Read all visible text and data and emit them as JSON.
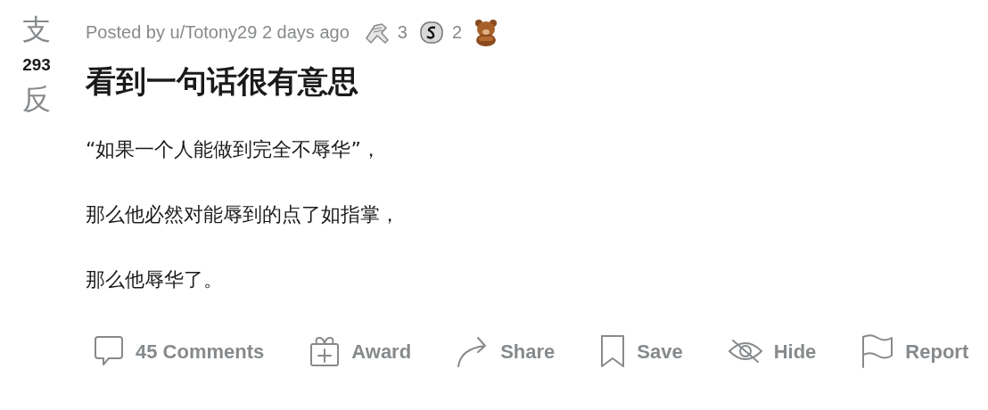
{
  "vote": {
    "up": "支",
    "score": "293",
    "down": "反"
  },
  "meta": {
    "posted": "Posted by u/Totony29 2 days ago"
  },
  "awards": [
    {
      "kind": "handshake",
      "count": "3"
    },
    {
      "kind": "silver",
      "count": "2"
    },
    {
      "kind": "bear"
    }
  ],
  "title": "看到一句话很有意思",
  "body": [
    "“如果一个人能做到完全不辱华”，",
    "那么他必然对能辱到的点了如指掌，",
    "那么他辱华了。"
  ],
  "actions": [
    {
      "kind": "comments",
      "label": "45 Comments"
    },
    {
      "kind": "award",
      "label": "Award"
    },
    {
      "kind": "share",
      "label": "Share"
    },
    {
      "kind": "save",
      "label": "Save"
    },
    {
      "kind": "hide",
      "label": "Hide"
    },
    {
      "kind": "report",
      "label": "Report"
    }
  ]
}
